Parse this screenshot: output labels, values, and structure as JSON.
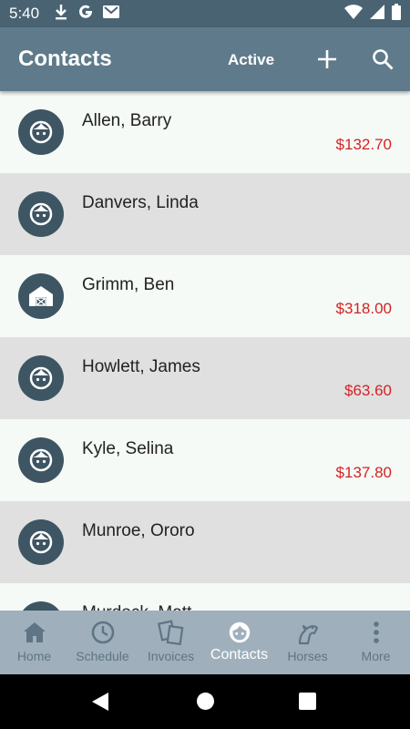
{
  "status_bar": {
    "time": "5:40",
    "icons_left": [
      "download-icon",
      "google-icon",
      "gmail-icon"
    ],
    "icons_right": [
      "wifi-icon",
      "signal-icon",
      "battery-icon"
    ]
  },
  "app_bar": {
    "title": "Contacts",
    "filter_label": "Active",
    "actions": [
      "add-icon",
      "search-icon"
    ]
  },
  "contacts": [
    {
      "name": "Allen, Barry",
      "balance": "$132.70",
      "avatar_icon": "person-icon"
    },
    {
      "name": "Danvers, Linda",
      "balance": "",
      "avatar_icon": "person-icon"
    },
    {
      "name": "Grimm, Ben",
      "balance": "$318.00",
      "avatar_icon": "barn-icon"
    },
    {
      "name": "Howlett, James",
      "balance": "$63.60",
      "avatar_icon": "person-icon"
    },
    {
      "name": "Kyle, Selina",
      "balance": "$137.80",
      "avatar_icon": "person-icon"
    },
    {
      "name": "Munroe, Ororo",
      "balance": "",
      "avatar_icon": "person-icon"
    },
    {
      "name": "Murdock, Matt",
      "balance": "",
      "avatar_icon": "person-icon"
    }
  ],
  "bottom_nav": [
    {
      "label": "Home",
      "icon": "home-icon",
      "active": false
    },
    {
      "label": "Schedule",
      "icon": "clock-icon",
      "active": false
    },
    {
      "label": "Invoices",
      "icon": "invoices-icon",
      "active": false
    },
    {
      "label": "Contacts",
      "icon": "person-icon",
      "active": true
    },
    {
      "label": "Horses",
      "icon": "horse-icon",
      "active": false
    },
    {
      "label": "More",
      "icon": "more-vertical-icon",
      "active": false
    }
  ],
  "colors": {
    "app_bar": "#5f7b8b",
    "status_bar": "#4a6373",
    "avatar": "#3e5563",
    "balance": "#d52222",
    "nav_bg": "#9fb0bc"
  }
}
